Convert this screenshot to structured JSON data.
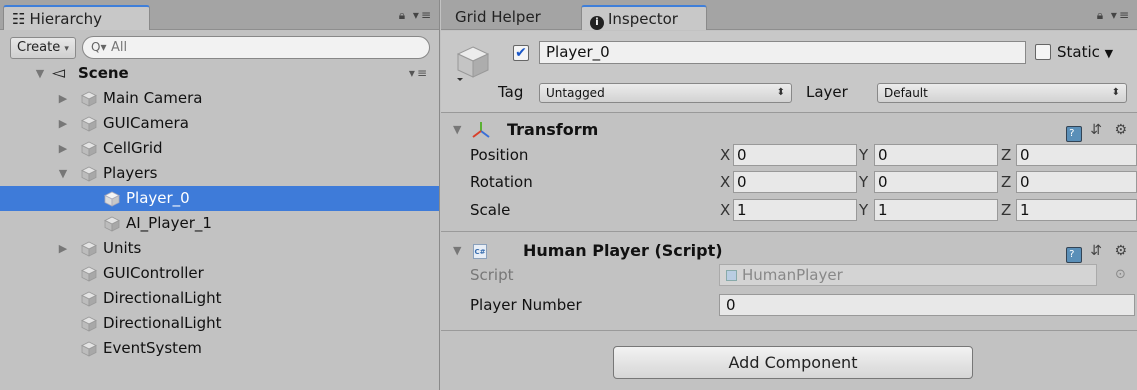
{
  "hierarchy": {
    "tab_label": "Hierarchy",
    "tab_icon": "list-icon",
    "create_label": "Create",
    "search_placeholder": "All",
    "scene": {
      "label": "Scene"
    },
    "items": [
      {
        "label": "Main Camera",
        "expandable": true,
        "expanded": false
      },
      {
        "label": "GUICamera",
        "expandable": true,
        "expanded": false
      },
      {
        "label": "CellGrid",
        "expandable": true,
        "expanded": false
      },
      {
        "label": "Players",
        "expandable": true,
        "expanded": true
      },
      {
        "label": "Player_0",
        "selected": true
      },
      {
        "label": "AI_Player_1"
      },
      {
        "label": "Units",
        "expandable": true,
        "expanded": false
      },
      {
        "label": "GUIController"
      },
      {
        "label": "DirectionalLight"
      },
      {
        "label": "DirectionalLight"
      },
      {
        "label": "EventSystem"
      }
    ]
  },
  "inspector": {
    "tabs": [
      {
        "label": "Grid Helper",
        "active": false
      },
      {
        "label": "Inspector",
        "active": true,
        "icon": "info-icon"
      }
    ],
    "object": {
      "active": true,
      "name": "Player_0",
      "static_label": "Static",
      "static_checked": false,
      "tag_label": "Tag",
      "tag_value": "Untagged",
      "layer_label": "Layer",
      "layer_value": "Default"
    },
    "transform": {
      "title": "Transform",
      "position": {
        "label": "Position",
        "x": "0",
        "y": "0",
        "z": "0"
      },
      "rotation": {
        "label": "Rotation",
        "x": "0",
        "y": "0",
        "z": "0"
      },
      "scale": {
        "label": "Scale",
        "x": "1",
        "y": "1",
        "z": "1"
      },
      "axis_labels": {
        "x": "X",
        "y": "Y",
        "z": "Z"
      }
    },
    "script_component": {
      "title": "Human Player (Script)",
      "script_label": "Script",
      "script_value": "HumanPlayer",
      "player_number_label": "Player Number",
      "player_number_value": "0"
    },
    "add_component_label": "Add Component"
  },
  "colors": {
    "selection": "#3e7bd9",
    "panel_bg": "#c2c2c2",
    "tabbar_bg": "#a4a4a4",
    "active_tab_accent": "#3f7fd9"
  }
}
